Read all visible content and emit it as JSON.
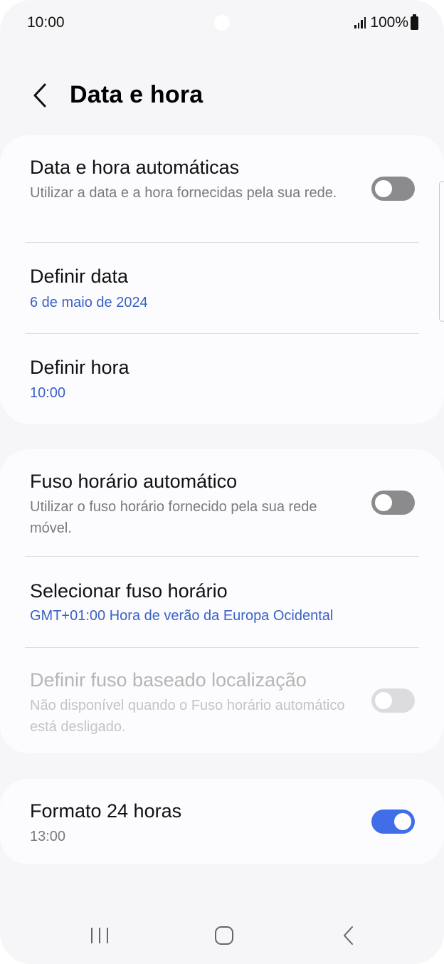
{
  "status_bar": {
    "time": "10:00",
    "battery": "100%",
    "icons": [
      "signal-icon",
      "battery-icon"
    ]
  },
  "header": {
    "title": "Data e hora",
    "back_icon": "chevron-left-icon"
  },
  "sections": {
    "auto_datetime": {
      "title": "Data e hora automáticas",
      "description": "Utilizar a data e a hora fornecidas pela sua rede.",
      "toggle": "off"
    },
    "set_date": {
      "title": "Definir data",
      "value": "6 de maio de 2024"
    },
    "set_time": {
      "title": "Definir hora",
      "value": "10:00"
    },
    "auto_timezone": {
      "title": "Fuso horário automático",
      "description": "Utilizar o fuso horário fornecido pela sua rede móvel.",
      "toggle": "off"
    },
    "select_timezone": {
      "title": "Selecionar fuso horário",
      "value": "GMT+01:00 Hora de verão da Europa Ocidental"
    },
    "location_timezone": {
      "title": "Definir fuso baseado localização",
      "description": "Não disponível quando o Fuso horário automático está desligado.",
      "toggle": "off",
      "enabled": false
    },
    "format_24h": {
      "title": "Formato 24 horas",
      "value": "13:00",
      "toggle": "on"
    }
  },
  "nav_bar": {
    "icons": [
      "recent-apps-icon",
      "home-icon",
      "back-icon"
    ]
  },
  "colors": {
    "accent": "#3f6ee8",
    "link": "#3a62c4",
    "background": "#f6f6f8",
    "card": "#fcfcfe"
  }
}
